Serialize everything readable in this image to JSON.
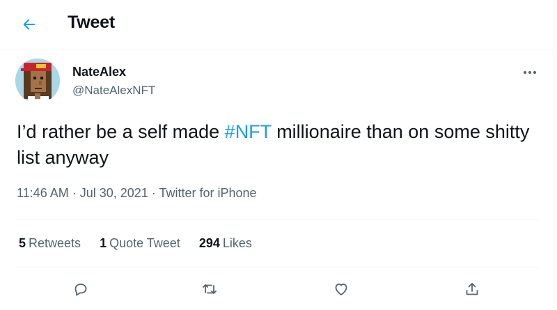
{
  "header": {
    "title": "Tweet",
    "back_icon": "back-arrow-icon",
    "accent_color": "#1d9bf0"
  },
  "author": {
    "display_name": "NateAlex",
    "handle": "@NateAlexNFT",
    "avatar_icon": "pixel-art-avatar"
  },
  "tweet": {
    "text_before": "I’d rather be a self made ",
    "hashtag": "#NFT",
    "text_after": " millionaire than on some shitty list anyway",
    "time": "11:46 AM",
    "separator": " · ",
    "date": "Jul 30, 2021",
    "source": "Twitter for iPhone"
  },
  "stats": {
    "retweets_count": "5",
    "retweets_label": "Retweets",
    "quotes_count": "1",
    "quotes_label": "Quote Tweet",
    "likes_count": "294",
    "likes_label": "Likes"
  },
  "actions": [
    "reply-icon",
    "retweet-icon",
    "like-icon",
    "share-icon"
  ]
}
